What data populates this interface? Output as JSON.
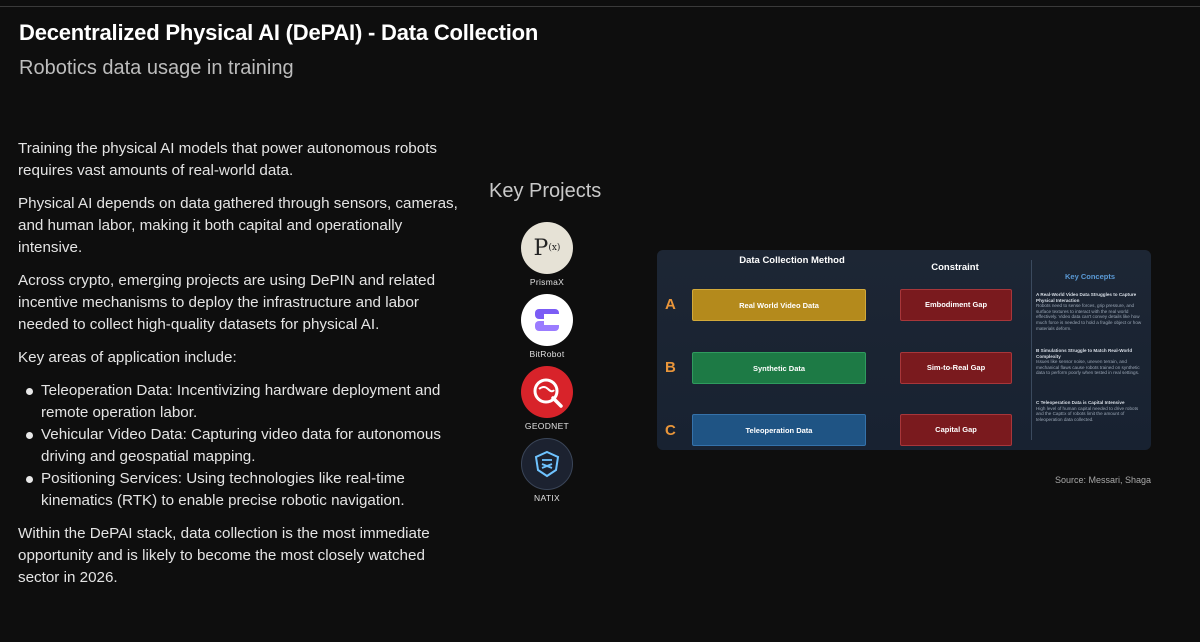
{
  "header": {
    "title": "Decentralized Physical AI (DePAI) - Data Collection",
    "subtitle": "Robotics data usage in training"
  },
  "body": {
    "p1": "Training the physical AI models that power autonomous robots requires vast amounts of real-world data.",
    "p2": "Physical AI depends on data gathered through sensors, cameras, and human labor, making it both capital and operationally intensive.",
    "p3": "Across crypto, emerging projects are using DePIN and related incentive mechanisms to deploy the infrastructure and labor needed to collect high-quality datasets for physical AI.",
    "p4": "Key areas of application include:",
    "bullets": [
      "Teleoperation Data: Incentivizing hardware deployment and remote operation labor.",
      "Vehicular Video Data: Capturing video data for autonomous driving and geospatial mapping.",
      "Positioning Services: Using technologies like real-time kinematics (RTK) to enable precise robotic navigation."
    ],
    "p5": "Within the DePAI stack, data collection is the most immediate opportunity and is likely to become the most closely watched sector in 2026."
  },
  "key_projects": {
    "title": "Key Projects",
    "items": [
      {
        "name": "PrismaX",
        "logo_text": "P",
        "logo_sup": "(x)",
        "icon": "prismax-logo"
      },
      {
        "name": "BitRobot",
        "icon": "bitrobot-logo"
      },
      {
        "name": "GEODNET",
        "icon": "geodnet-logo"
      },
      {
        "name": "NATIX",
        "icon": "natix-logo"
      }
    ]
  },
  "diagram": {
    "col_method": "Data Collection Method",
    "col_constraint": "Constraint",
    "key_concepts_title": "Key Concepts",
    "rows": [
      {
        "letter": "A",
        "method": "Real World Video Data",
        "constraint": "Embodiment Gap",
        "method_color": "#b48a1c"
      },
      {
        "letter": "B",
        "method": "Synthetic Data",
        "constraint": "Sim-to-Real Gap",
        "method_color": "#1d7a45"
      },
      {
        "letter": "C",
        "method": "Teleoperation Data",
        "constraint": "Capital Gap",
        "method_color": "#1f5484"
      }
    ],
    "concepts": [
      {
        "head": "A Real-World Video Data Struggles to Capture Physical Interaction",
        "text": "Robots need to sense forces, grip pressure, and surface textures to interact with the real world effectively. Video data can't convey details like how much force is needed to hold a fragile object or how materials deform."
      },
      {
        "head": "B Simulations Struggle to Match Real-World Complexity",
        "text": "Issues like sensor noise, uneven terrain, and mechanical flaws cause robots trained on synthetic data to perform poorly when tested in real settings."
      },
      {
        "head": "C Teleoperation Data is Capital Intensive",
        "text": "High level of human capital needed to drive robots and the CapEx of robots limit the amount of teleoperation data collected."
      }
    ]
  },
  "source": "Source: Messari, Shaga",
  "colors": {
    "background": "#0e0e0e",
    "accent_letter": "#e8953a",
    "constraint_box": "#7a1a1e",
    "key_concepts": "#5a9ad6"
  }
}
